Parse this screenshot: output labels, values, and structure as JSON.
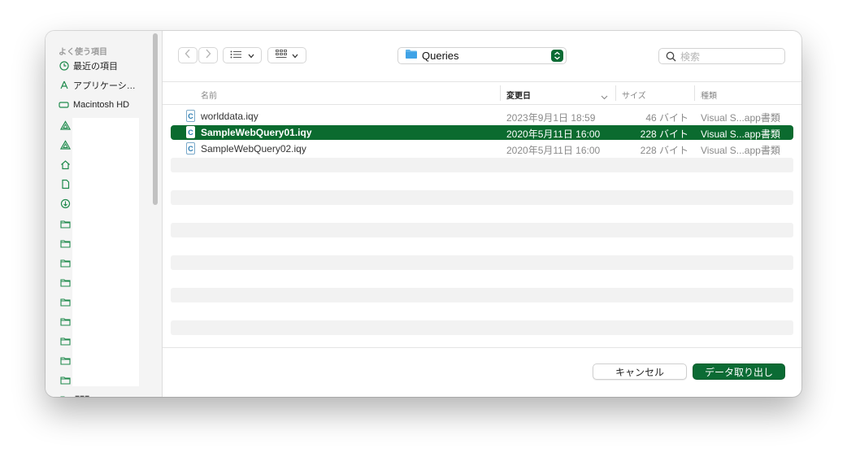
{
  "sidebar": {
    "section_title": "よく使う項目",
    "items": [
      {
        "label": "最近の項目",
        "icon": "clock-icon"
      },
      {
        "label": "アプリケーシ…",
        "icon": "applications-icon"
      },
      {
        "label": "Macintosh HD",
        "icon": "disk-icon"
      }
    ],
    "icons": [
      "google-drive-icon",
      "google-drive-icon",
      "home-icon",
      "document-icon",
      "download-icon",
      "folder-icon",
      "folder-icon",
      "folder-icon",
      "folder-icon",
      "folder-icon",
      "folder-icon",
      "folder-icon",
      "folder-icon",
      "folder-icon"
    ],
    "cut_label": "■■■"
  },
  "toolbar": {
    "back_icon": "chevron-left-icon",
    "forward_icon": "chevron-right-icon",
    "view_list_icon": "list-view-icon",
    "view_grid_icon": "icon-view-icon",
    "path": "Queries",
    "search_placeholder": "検索"
  },
  "columns": {
    "name": "名前",
    "date": "変更日",
    "size": "サイズ",
    "kind": "種類"
  },
  "files": [
    {
      "name": "worlddata.iqy",
      "date": "2023年9月1日 18:59",
      "size": "46 バイト",
      "kind": "Visual S...app書類",
      "selected": false
    },
    {
      "name": "SampleWebQuery01.iqy",
      "date": "2020年5月11日 16:00",
      "size": "228 バイト",
      "kind": "Visual S...app書類",
      "selected": true
    },
    {
      "name": "SampleWebQuery02.iqy",
      "date": "2020年5月11日 16:00",
      "size": "228 バイト",
      "kind": "Visual S...app書類",
      "selected": false
    }
  ],
  "file_icon_glyph": "C",
  "buttons": {
    "cancel": "キャンセル",
    "open": "データ取り出し"
  },
  "colors": {
    "accent": "#0b6b34",
    "selection": "#0b6b2f",
    "sidebar_icon": "#1f8a4c"
  }
}
